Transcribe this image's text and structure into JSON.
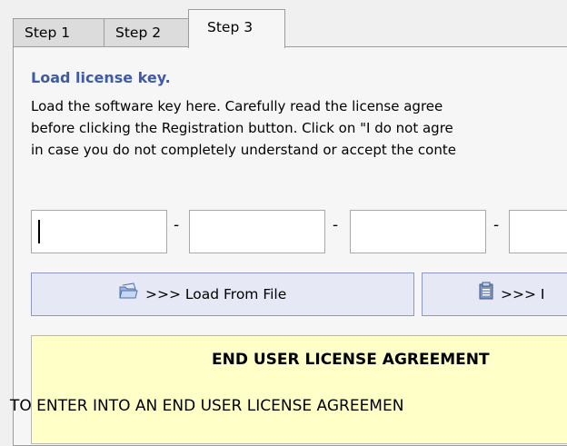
{
  "tabs": [
    "Step 1",
    "Step 2",
    "Step 3"
  ],
  "section": {
    "heading": "Load license key.",
    "lines": [
      "Load the software key here. Carefully read the license agree",
      "before clicking the Registration button. Click on \"I do not agre",
      "in case you do not completely understand or accept the conte"
    ]
  },
  "key": {
    "separator": "-",
    "values": [
      "",
      "",
      "",
      ""
    ]
  },
  "buttons": {
    "load_file": ">>> Load From File",
    "load_clipboard": ">>> I"
  },
  "eula": {
    "title": "END USER LICENSE AGREEMENT",
    "text": "TO ENTER INTO AN END USER LICENSE AGREEMEN"
  }
}
